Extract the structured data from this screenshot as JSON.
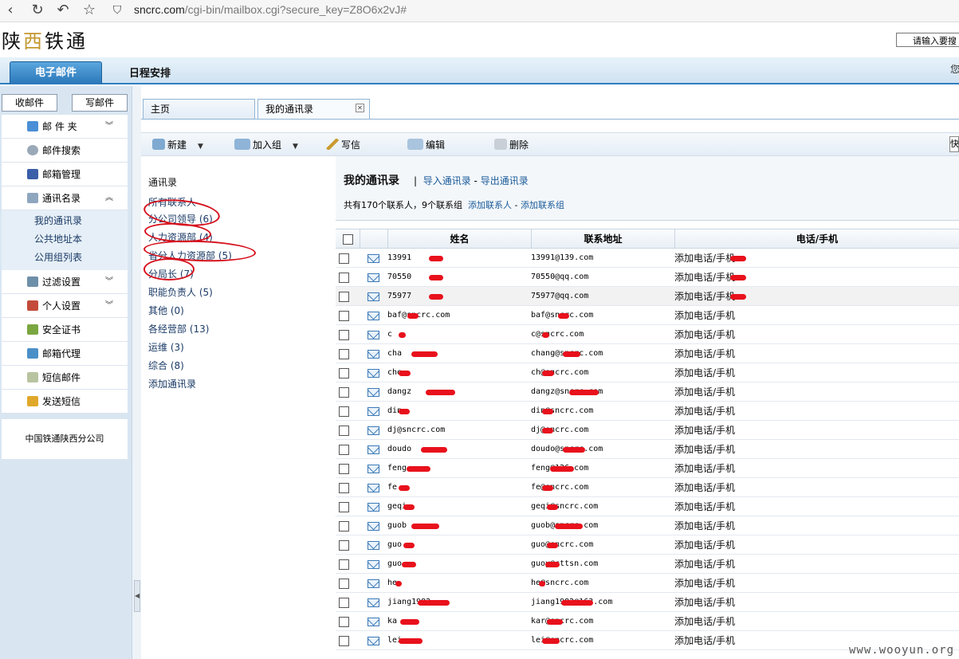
{
  "browser": {
    "url_host": "sncrc.com",
    "url_path": "/cgi-bin/mailbox.cgi?secure_key=Z8O6x2vJ#"
  },
  "header": {
    "logo_left": "陕",
    "logo_mid": "西",
    "logo_right": "铁通",
    "search_placeholder": "请输入要搜",
    "tabs": [
      {
        "label": "电子邮件"
      },
      {
        "label": "日程安排"
      }
    ],
    "right_text": "您"
  },
  "sidebar": {
    "inbox_button": "收邮件",
    "compose_button": "写邮件",
    "items": [
      {
        "label": "邮 件 夹",
        "icon": "folder-icon",
        "chevron": "»"
      },
      {
        "label": "邮件搜索",
        "icon": "search-icon"
      },
      {
        "label": "邮箱管理",
        "icon": "mailbox-icon"
      },
      {
        "label": "通讯名录",
        "icon": "addressbook-icon",
        "chevron": "«"
      },
      {
        "label": "过滤设置",
        "icon": "filter-icon",
        "chevron": "»"
      },
      {
        "label": "个人设置",
        "icon": "user-settings-icon",
        "chevron": "»"
      },
      {
        "label": "安全证书",
        "icon": "certificate-icon"
      },
      {
        "label": "邮箱代理",
        "icon": "proxy-icon"
      },
      {
        "label": "短信邮件",
        "icon": "sms-mail-icon"
      },
      {
        "label": "发送短信",
        "icon": "send-sms-icon"
      }
    ],
    "sub_items": [
      "我的通讯录",
      "公共地址本",
      "公用组列表"
    ],
    "company": "中国铁通陕西分公司"
  },
  "page_tabs": [
    {
      "label": "主页"
    },
    {
      "label": "我的通讯录"
    }
  ],
  "toolbar": {
    "new": "新建",
    "add_group": "加入组",
    "write": "写信",
    "edit": "编辑",
    "delete": "删除",
    "quick": "快"
  },
  "groups": {
    "title": "通讯录",
    "items": [
      "所有联系人",
      "分公司领导 (6)",
      "人力资源部 (4)",
      "省分人力资源部 (5)",
      "分局长 (7)",
      "职能负责人 (5)",
      "其他 (0)",
      "各经营部 (13)",
      "运维 (3)",
      "综合 (8)",
      "添加通讯录"
    ]
  },
  "main": {
    "title": "我的通讯录",
    "sep": "|",
    "import": "导入通讯录",
    "dash": "-",
    "export": "导出通讯录",
    "summary": "共有170个联系人，9个联系组",
    "add_contact": "添加联系人",
    "add_group": "添加联系组",
    "columns": [
      "姓名",
      "联系地址",
      "电话/手机"
    ],
    "rows": [
      {
        "name": "13991",
        "email": "13991@139.com",
        "phone": "添加电话/手机"
      },
      {
        "name": "70550",
        "email": "70550@qq.com",
        "phone": "添加电话/手机"
      },
      {
        "name": "75977",
        "email": "75977@qq.com",
        "phone": "添加电话/手机"
      },
      {
        "name": "baf@sncrc.com",
        "email": "baf@sncrc.com",
        "phone": "添加电话/手机"
      },
      {
        "name": "c",
        "email": "c@sncrc.com",
        "phone": "添加电话/手机"
      },
      {
        "name": "cha",
        "email": "chang@sncrc.com",
        "phone": "添加电话/手机"
      },
      {
        "name": "che",
        "email": "ch@sncrc.com",
        "phone": "添加电话/手机"
      },
      {
        "name": "dangz",
        "email": "dangz@sncrc.com",
        "phone": "添加电话/手机"
      },
      {
        "name": "din",
        "email": "din@sncrc.com",
        "phone": "添加电话/手机"
      },
      {
        "name": "dj@sncrc.com",
        "email": "dj@sncrc.com",
        "phone": "添加电话/手机"
      },
      {
        "name": "doudo",
        "email": "doudo@sncrc.com",
        "phone": "添加电话/手机"
      },
      {
        "name": "feng",
        "email": "feng@126.com",
        "phone": "添加电话/手机"
      },
      {
        "name": "fe",
        "email": "fe@sncrc.com",
        "phone": "添加电话/手机"
      },
      {
        "name": "geqi",
        "email": "geqi@sncrc.com",
        "phone": "添加电话/手机"
      },
      {
        "name": "guob",
        "email": "guob@sncrc.com",
        "phone": "添加电话/手机"
      },
      {
        "name": "guo",
        "email": "guo@sncrc.com",
        "phone": "添加电话/手机"
      },
      {
        "name": "guo",
        "email": "guoy@cttsn.com",
        "phone": "添加电话/手机"
      },
      {
        "name": "he",
        "email": "he@sncrc.com",
        "phone": "添加电话/手机"
      },
      {
        "name": "jiang1982",
        "email": "jiang1982@163.com",
        "phone": "添加电话/手机"
      },
      {
        "name": "ka",
        "email": "kar@sncrc.com",
        "phone": "添加电话/手机"
      },
      {
        "name": "lei",
        "email": "lei@sncrc.com",
        "phone": "添加电话/手机"
      }
    ]
  },
  "watermark": "www.wooyun.org",
  "colors": {
    "accent": "#2b78ba",
    "link": "#1a5b9a",
    "annotation": "#d6101c"
  }
}
